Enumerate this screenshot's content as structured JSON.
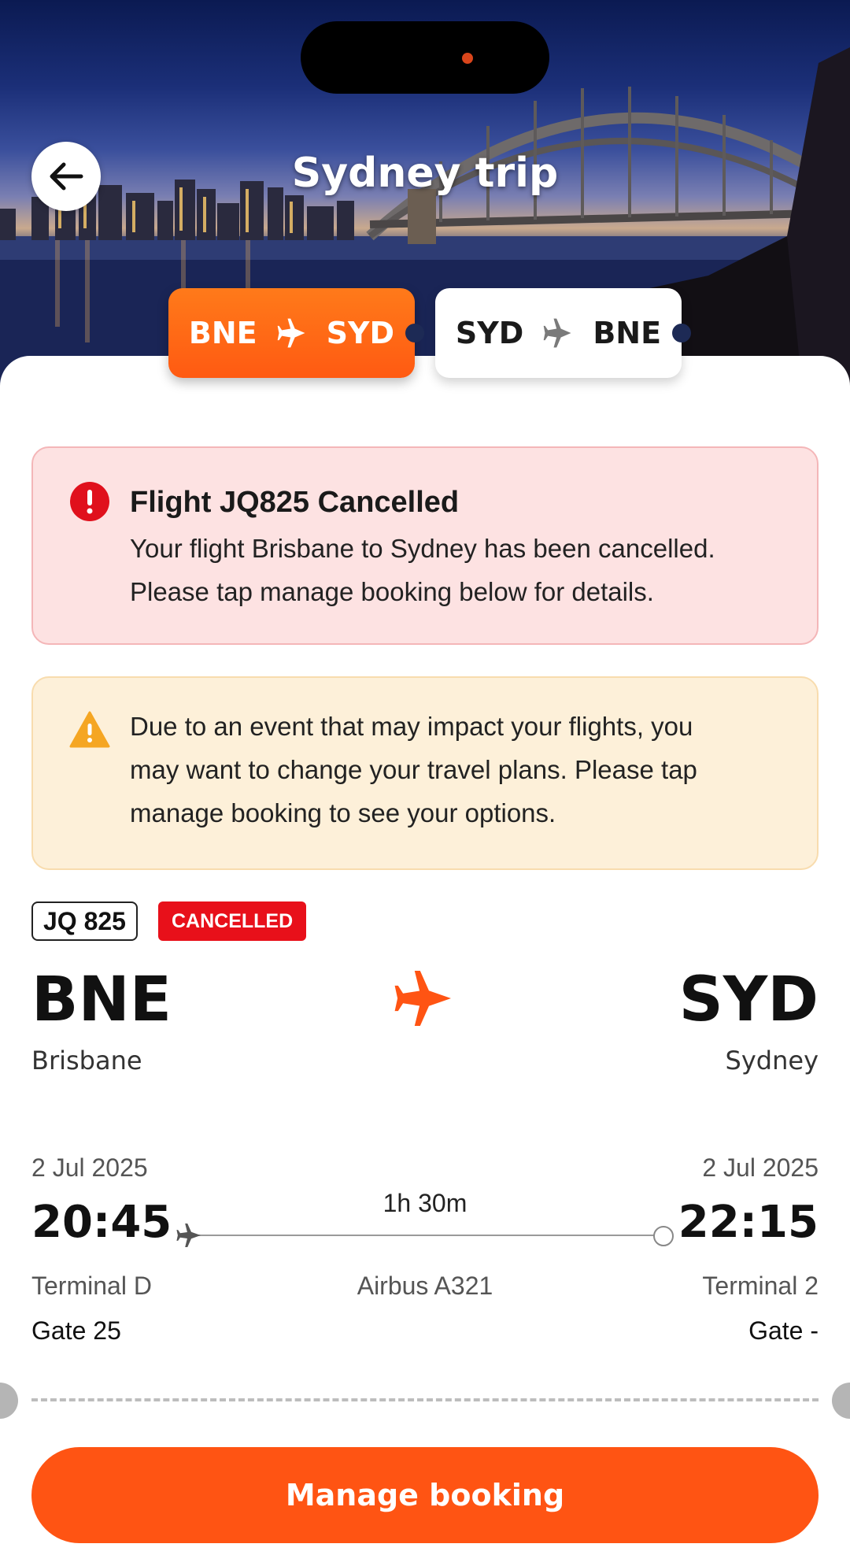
{
  "header": {
    "title": "Sydney trip",
    "back_icon": "arrow-left-icon"
  },
  "legs": [
    {
      "from": "BNE",
      "to": "SYD",
      "selected": true
    },
    {
      "from": "SYD",
      "to": "BNE",
      "selected": false
    }
  ],
  "alerts": {
    "error": {
      "icon": "exclamation-circle-icon",
      "title": "Flight JQ825 Cancelled",
      "line1": "Your flight Brisbane to Sydney has been cancelled.",
      "line2": "Please tap manage booking below for details."
    },
    "warning": {
      "icon": "warning-triangle-icon",
      "line1": "Due to an event that may impact your flights, you",
      "line2": "may want to change your travel plans. Please tap",
      "line3": "manage booking to see your options."
    }
  },
  "flight": {
    "number": "JQ 825",
    "status": "CANCELLED",
    "origin": {
      "code": "BNE",
      "city": "Brisbane",
      "date": "2 Jul 2025",
      "time": "20:45",
      "terminal": "Terminal D",
      "gate": "Gate 25"
    },
    "destination": {
      "code": "SYD",
      "city": "Sydney",
      "date": "2 Jul 2025",
      "time": "22:15",
      "terminal": "Terminal 2",
      "gate": "Gate -"
    },
    "duration": "1h 30m",
    "aircraft": "Airbus A321"
  },
  "actions": {
    "manage_booking": "Manage booking"
  },
  "colors": {
    "brand_orange": "#ff5413",
    "error_bg": "#fde2e2",
    "warning_bg": "#fdf0d9",
    "cancelled_red": "#e8101a"
  }
}
